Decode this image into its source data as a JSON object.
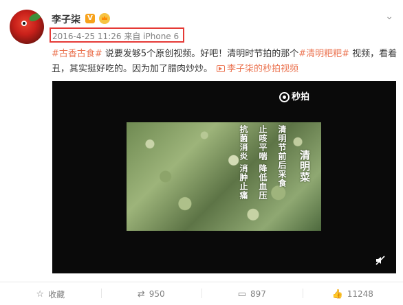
{
  "post": {
    "author": "李子柒",
    "verified_badge": "V",
    "meta_time": "2016-4-25 11:26",
    "meta_from": "来自",
    "meta_device": "iPhone 6",
    "hashtag1": "#古香古食#",
    "text1": " 说要发够5个原创视频。好吧！清明时节拍的那个",
    "hashtag2": "#清明粑粑#",
    "text2": " 视频，看着丑，其实挺好吃的。因为加了腊肉炒炒。",
    "video_link": "李子柒的秒拍视频"
  },
  "video": {
    "watermark": "秒拍",
    "caption_cols": [
      "清明菜",
      "清明节前后采食",
      "止咳平喘 降低血压",
      "抗菌消炎 消肿止痛"
    ]
  },
  "actions": {
    "favorite": "收藏",
    "repost_count": "950",
    "comment_count": "897",
    "like_count": "11248"
  },
  "colors": {
    "accent": "#eb7350",
    "highlight_box": "#e53935",
    "verified": "#f7a21c"
  },
  "icons": [
    "chevron-down-icon",
    "verified-icon",
    "vip-crown-icon",
    "video-link-icon",
    "camera-icon",
    "mute-icon",
    "star-icon",
    "repost-icon",
    "comment-icon",
    "like-icon"
  ]
}
